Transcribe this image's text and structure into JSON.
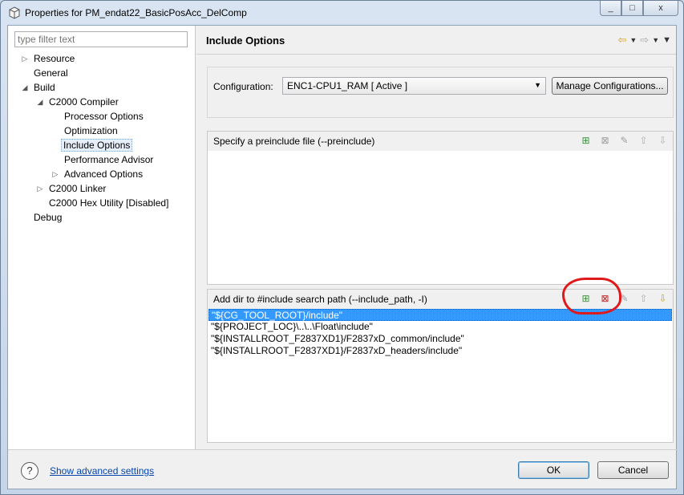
{
  "window": {
    "title": "Properties for PM_endat22_BasicPosAcc_DelComp",
    "controls": [
      "_",
      "□",
      "x"
    ]
  },
  "sidebar": {
    "filter_placeholder": "type filter text",
    "tree": [
      {
        "label": "Resource",
        "expander": "▷"
      },
      {
        "label": "General",
        "expander": ""
      },
      {
        "label": "Build",
        "expander": "◢"
      },
      {
        "label": "C2000 Compiler",
        "expander": "◢"
      },
      {
        "label": "Processor Options",
        "expander": ""
      },
      {
        "label": "Optimization",
        "expander": ""
      },
      {
        "label": "Include Options",
        "expander": "",
        "selected": true
      },
      {
        "label": "Performance Advisor",
        "expander": ""
      },
      {
        "label": "Advanced Options",
        "expander": "▷"
      },
      {
        "label": "C2000 Linker",
        "expander": "▷"
      },
      {
        "label": "C2000 Hex Utility  [Disabled]",
        "expander": ""
      },
      {
        "label": "Debug",
        "expander": ""
      }
    ]
  },
  "main": {
    "title": "Include Options",
    "configuration": {
      "label": "Configuration:",
      "value": "ENC1-CPU1_RAM  [ Active ]",
      "manage_label": "Manage Configurations..."
    },
    "preinclude": {
      "title": "Specify a preinclude file (--preinclude)",
      "items": []
    },
    "include_path": {
      "title": "Add dir to #include search path (--include_path, -I)",
      "items": [
        "\"${CG_TOOL_ROOT}/include\"",
        "\"${PROJECT_LOC}\\..\\..\\Float\\include\"",
        "\"${INSTALLROOT_F2837XD1}/F2837xD_common/include\"",
        "\"${INSTALLROOT_F2837XD1}/F2837xD_headers/include\""
      ],
      "selected_index": 0
    }
  },
  "footer": {
    "help_glyph": "?",
    "advanced_link": "Show advanced settings",
    "ok_label": "OK",
    "cancel_label": "Cancel"
  },
  "icons": {
    "add": "add-icon",
    "delete": "delete-icon",
    "edit": "edit-icon",
    "move_up": "move-up-icon",
    "move_down": "move-down-icon"
  },
  "colors": {
    "selection": "#3399ff",
    "link": "#0645ad",
    "annotation": "#e0191d"
  }
}
